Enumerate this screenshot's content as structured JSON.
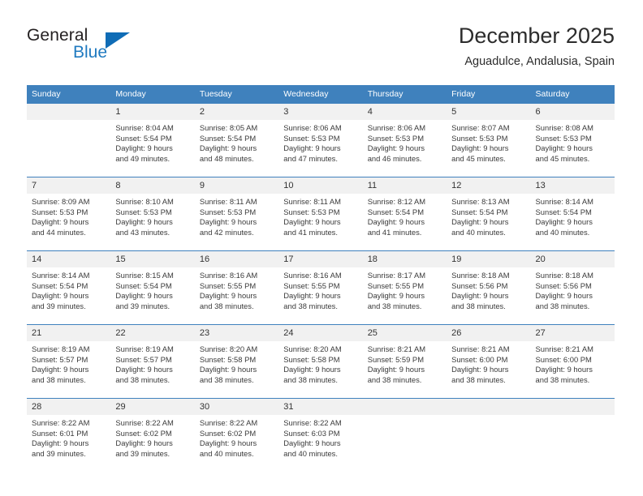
{
  "logo": {
    "word_one": "General",
    "word_two": "Blue",
    "accent_color": "#0f6cb6",
    "text_color": "#231f20"
  },
  "header": {
    "title": "December 2025",
    "location": "Aguadulce, Andalusia, Spain"
  },
  "calendar": {
    "header_bg": "#3f81bd",
    "daynum_bg": "#f1f1f1",
    "weekdays": [
      "Sunday",
      "Monday",
      "Tuesday",
      "Wednesday",
      "Thursday",
      "Friday",
      "Saturday"
    ],
    "weeks": [
      [
        {
          "day": "",
          "lines": []
        },
        {
          "day": "1",
          "lines": [
            "Sunrise: 8:04 AM",
            "Sunset: 5:54 PM",
            "Daylight: 9 hours",
            "and 49 minutes."
          ]
        },
        {
          "day": "2",
          "lines": [
            "Sunrise: 8:05 AM",
            "Sunset: 5:54 PM",
            "Daylight: 9 hours",
            "and 48 minutes."
          ]
        },
        {
          "day": "3",
          "lines": [
            "Sunrise: 8:06 AM",
            "Sunset: 5:53 PM",
            "Daylight: 9 hours",
            "and 47 minutes."
          ]
        },
        {
          "day": "4",
          "lines": [
            "Sunrise: 8:06 AM",
            "Sunset: 5:53 PM",
            "Daylight: 9 hours",
            "and 46 minutes."
          ]
        },
        {
          "day": "5",
          "lines": [
            "Sunrise: 8:07 AM",
            "Sunset: 5:53 PM",
            "Daylight: 9 hours",
            "and 45 minutes."
          ]
        },
        {
          "day": "6",
          "lines": [
            "Sunrise: 8:08 AM",
            "Sunset: 5:53 PM",
            "Daylight: 9 hours",
            "and 45 minutes."
          ]
        }
      ],
      [
        {
          "day": "7",
          "lines": [
            "Sunrise: 8:09 AM",
            "Sunset: 5:53 PM",
            "Daylight: 9 hours",
            "and 44 minutes."
          ]
        },
        {
          "day": "8",
          "lines": [
            "Sunrise: 8:10 AM",
            "Sunset: 5:53 PM",
            "Daylight: 9 hours",
            "and 43 minutes."
          ]
        },
        {
          "day": "9",
          "lines": [
            "Sunrise: 8:11 AM",
            "Sunset: 5:53 PM",
            "Daylight: 9 hours",
            "and 42 minutes."
          ]
        },
        {
          "day": "10",
          "lines": [
            "Sunrise: 8:11 AM",
            "Sunset: 5:53 PM",
            "Daylight: 9 hours",
            "and 41 minutes."
          ]
        },
        {
          "day": "11",
          "lines": [
            "Sunrise: 8:12 AM",
            "Sunset: 5:54 PM",
            "Daylight: 9 hours",
            "and 41 minutes."
          ]
        },
        {
          "day": "12",
          "lines": [
            "Sunrise: 8:13 AM",
            "Sunset: 5:54 PM",
            "Daylight: 9 hours",
            "and 40 minutes."
          ]
        },
        {
          "day": "13",
          "lines": [
            "Sunrise: 8:14 AM",
            "Sunset: 5:54 PM",
            "Daylight: 9 hours",
            "and 40 minutes."
          ]
        }
      ],
      [
        {
          "day": "14",
          "lines": [
            "Sunrise: 8:14 AM",
            "Sunset: 5:54 PM",
            "Daylight: 9 hours",
            "and 39 minutes."
          ]
        },
        {
          "day": "15",
          "lines": [
            "Sunrise: 8:15 AM",
            "Sunset: 5:54 PM",
            "Daylight: 9 hours",
            "and 39 minutes."
          ]
        },
        {
          "day": "16",
          "lines": [
            "Sunrise: 8:16 AM",
            "Sunset: 5:55 PM",
            "Daylight: 9 hours",
            "and 38 minutes."
          ]
        },
        {
          "day": "17",
          "lines": [
            "Sunrise: 8:16 AM",
            "Sunset: 5:55 PM",
            "Daylight: 9 hours",
            "and 38 minutes."
          ]
        },
        {
          "day": "18",
          "lines": [
            "Sunrise: 8:17 AM",
            "Sunset: 5:55 PM",
            "Daylight: 9 hours",
            "and 38 minutes."
          ]
        },
        {
          "day": "19",
          "lines": [
            "Sunrise: 8:18 AM",
            "Sunset: 5:56 PM",
            "Daylight: 9 hours",
            "and 38 minutes."
          ]
        },
        {
          "day": "20",
          "lines": [
            "Sunrise: 8:18 AM",
            "Sunset: 5:56 PM",
            "Daylight: 9 hours",
            "and 38 minutes."
          ]
        }
      ],
      [
        {
          "day": "21",
          "lines": [
            "Sunrise: 8:19 AM",
            "Sunset: 5:57 PM",
            "Daylight: 9 hours",
            "and 38 minutes."
          ]
        },
        {
          "day": "22",
          "lines": [
            "Sunrise: 8:19 AM",
            "Sunset: 5:57 PM",
            "Daylight: 9 hours",
            "and 38 minutes."
          ]
        },
        {
          "day": "23",
          "lines": [
            "Sunrise: 8:20 AM",
            "Sunset: 5:58 PM",
            "Daylight: 9 hours",
            "and 38 minutes."
          ]
        },
        {
          "day": "24",
          "lines": [
            "Sunrise: 8:20 AM",
            "Sunset: 5:58 PM",
            "Daylight: 9 hours",
            "and 38 minutes."
          ]
        },
        {
          "day": "25",
          "lines": [
            "Sunrise: 8:21 AM",
            "Sunset: 5:59 PM",
            "Daylight: 9 hours",
            "and 38 minutes."
          ]
        },
        {
          "day": "26",
          "lines": [
            "Sunrise: 8:21 AM",
            "Sunset: 6:00 PM",
            "Daylight: 9 hours",
            "and 38 minutes."
          ]
        },
        {
          "day": "27",
          "lines": [
            "Sunrise: 8:21 AM",
            "Sunset: 6:00 PM",
            "Daylight: 9 hours",
            "and 38 minutes."
          ]
        }
      ],
      [
        {
          "day": "28",
          "lines": [
            "Sunrise: 8:22 AM",
            "Sunset: 6:01 PM",
            "Daylight: 9 hours",
            "and 39 minutes."
          ]
        },
        {
          "day": "29",
          "lines": [
            "Sunrise: 8:22 AM",
            "Sunset: 6:02 PM",
            "Daylight: 9 hours",
            "and 39 minutes."
          ]
        },
        {
          "day": "30",
          "lines": [
            "Sunrise: 8:22 AM",
            "Sunset: 6:02 PM",
            "Daylight: 9 hours",
            "and 40 minutes."
          ]
        },
        {
          "day": "31",
          "lines": [
            "Sunrise: 8:22 AM",
            "Sunset: 6:03 PM",
            "Daylight: 9 hours",
            "and 40 minutes."
          ]
        },
        {
          "day": "",
          "lines": []
        },
        {
          "day": "",
          "lines": []
        },
        {
          "day": "",
          "lines": []
        }
      ]
    ]
  }
}
